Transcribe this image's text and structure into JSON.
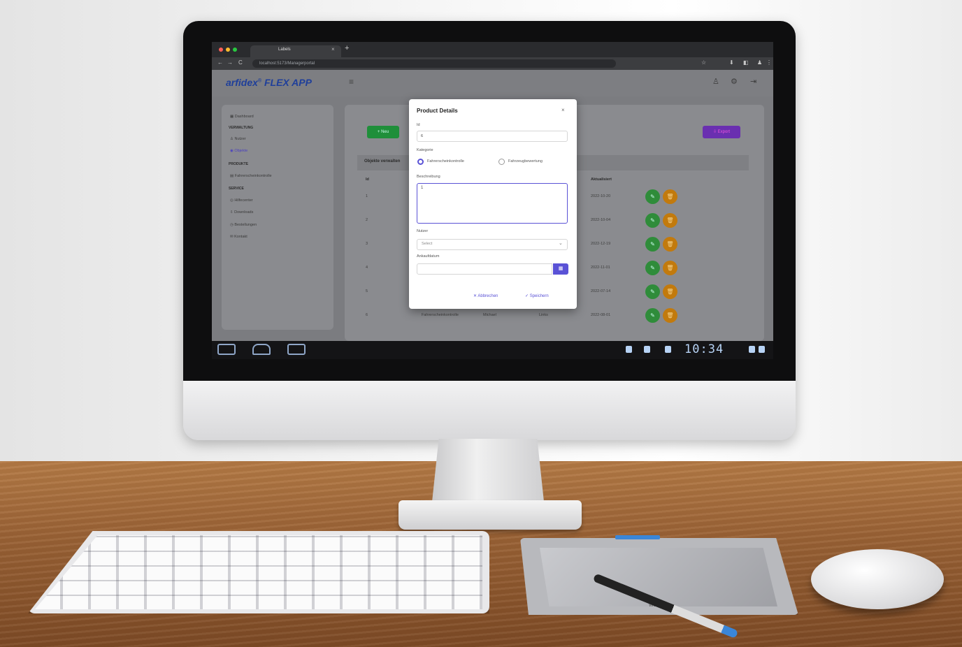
{
  "browser": {
    "tab_title": "Labels",
    "tab_close": "×",
    "new_tab": "+",
    "url": "localhost:5173/Managerportal",
    "nav_back": "←",
    "nav_forward": "→",
    "nav_reload": "C"
  },
  "app": {
    "brand_prefix": "arfidex",
    "brand_reg": "®",
    "brand_flex": "FLEX",
    "brand_app": "APP",
    "menu_icon": "≡"
  },
  "sidebar": {
    "items": [
      {
        "type": "item",
        "label": "Dashboard"
      },
      {
        "type": "heading",
        "label": "VERWALTUNG"
      },
      {
        "type": "item",
        "label": "Nutzer"
      },
      {
        "type": "item",
        "label": "Objekte",
        "active": true
      },
      {
        "type": "heading",
        "label": "PRODUKTE"
      },
      {
        "type": "item",
        "label": "Fahrerscheinkontrolle"
      },
      {
        "type": "heading",
        "label": "SERVICE"
      },
      {
        "type": "item",
        "label": "Hilfecenter"
      },
      {
        "type": "item",
        "label": "Downloads"
      },
      {
        "type": "item",
        "label": "Bestellungen"
      },
      {
        "type": "item",
        "label": "Kontakt"
      }
    ]
  },
  "toolbar": {
    "new_label": "+ Neu",
    "export_label": "⇩ Export"
  },
  "table": {
    "title": "Objekte verwalten",
    "headers": [
      "Id",
      "Aktualisiert"
    ],
    "rows": [
      {
        "id": "1",
        "type": "",
        "user": "",
        "loc": "",
        "date": "2022-10-20"
      },
      {
        "id": "2",
        "type": "",
        "user": "",
        "loc": "",
        "date": "2022-10-04"
      },
      {
        "id": "3",
        "type": "",
        "user": "",
        "loc": "",
        "date": "2022-12-19"
      },
      {
        "id": "4",
        "type": "",
        "user": "",
        "loc": "",
        "date": "2022-11-01"
      },
      {
        "id": "5",
        "type": "",
        "user": "",
        "loc": "",
        "date": "2022-07-14"
      },
      {
        "id": "6",
        "type": "Fahrerscheinkontrolle",
        "user": "Michael",
        "loc": "Links",
        "date": "2022-08-01"
      }
    ]
  },
  "modal": {
    "title": "Product Details",
    "close": "×",
    "id_label": "Id",
    "id_value": "6",
    "category_label": "Kategorie",
    "category_options": [
      "Fahrerscheinkontrolle",
      "Fahrzeugbewertung"
    ],
    "category_selected": 0,
    "description_label": "Beschreibung",
    "description_value": "1",
    "user_label": "Nutzer",
    "user_value": "Select",
    "date_label": "Ankaufdatum",
    "cancel_label": "✕ Abbrechen",
    "save_label": "✓ Speichern"
  },
  "android": {
    "clock": "10:34"
  },
  "tablet": {
    "brand": "wacom"
  }
}
